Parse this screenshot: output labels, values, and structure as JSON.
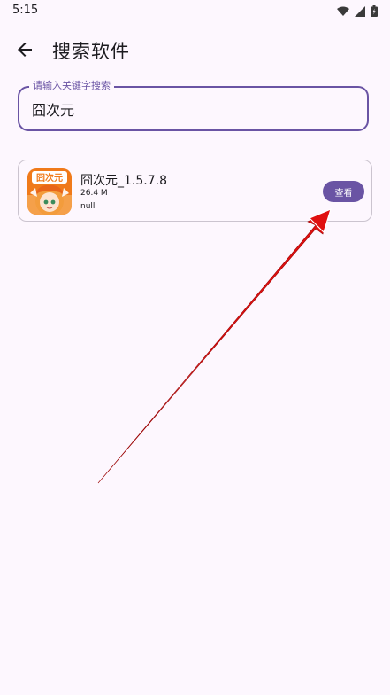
{
  "status_bar": {
    "time": "5:15",
    "icons": [
      "wifi-icon",
      "signal-icon",
      "battery-icon"
    ]
  },
  "app_bar": {
    "back_icon": "arrow-left-icon",
    "title": "搜索软件"
  },
  "search": {
    "label": "请输入关键字搜索",
    "value": "囧次元"
  },
  "results": [
    {
      "icon_text": "囧次元",
      "name": "囧次元_1.5.7.8",
      "size": "26.4 M",
      "description": "null",
      "action_label": "查看"
    }
  ],
  "colors": {
    "accent": "#6a54a4",
    "background": "#fdf7fe",
    "annotation_arrow": "#e01010"
  }
}
